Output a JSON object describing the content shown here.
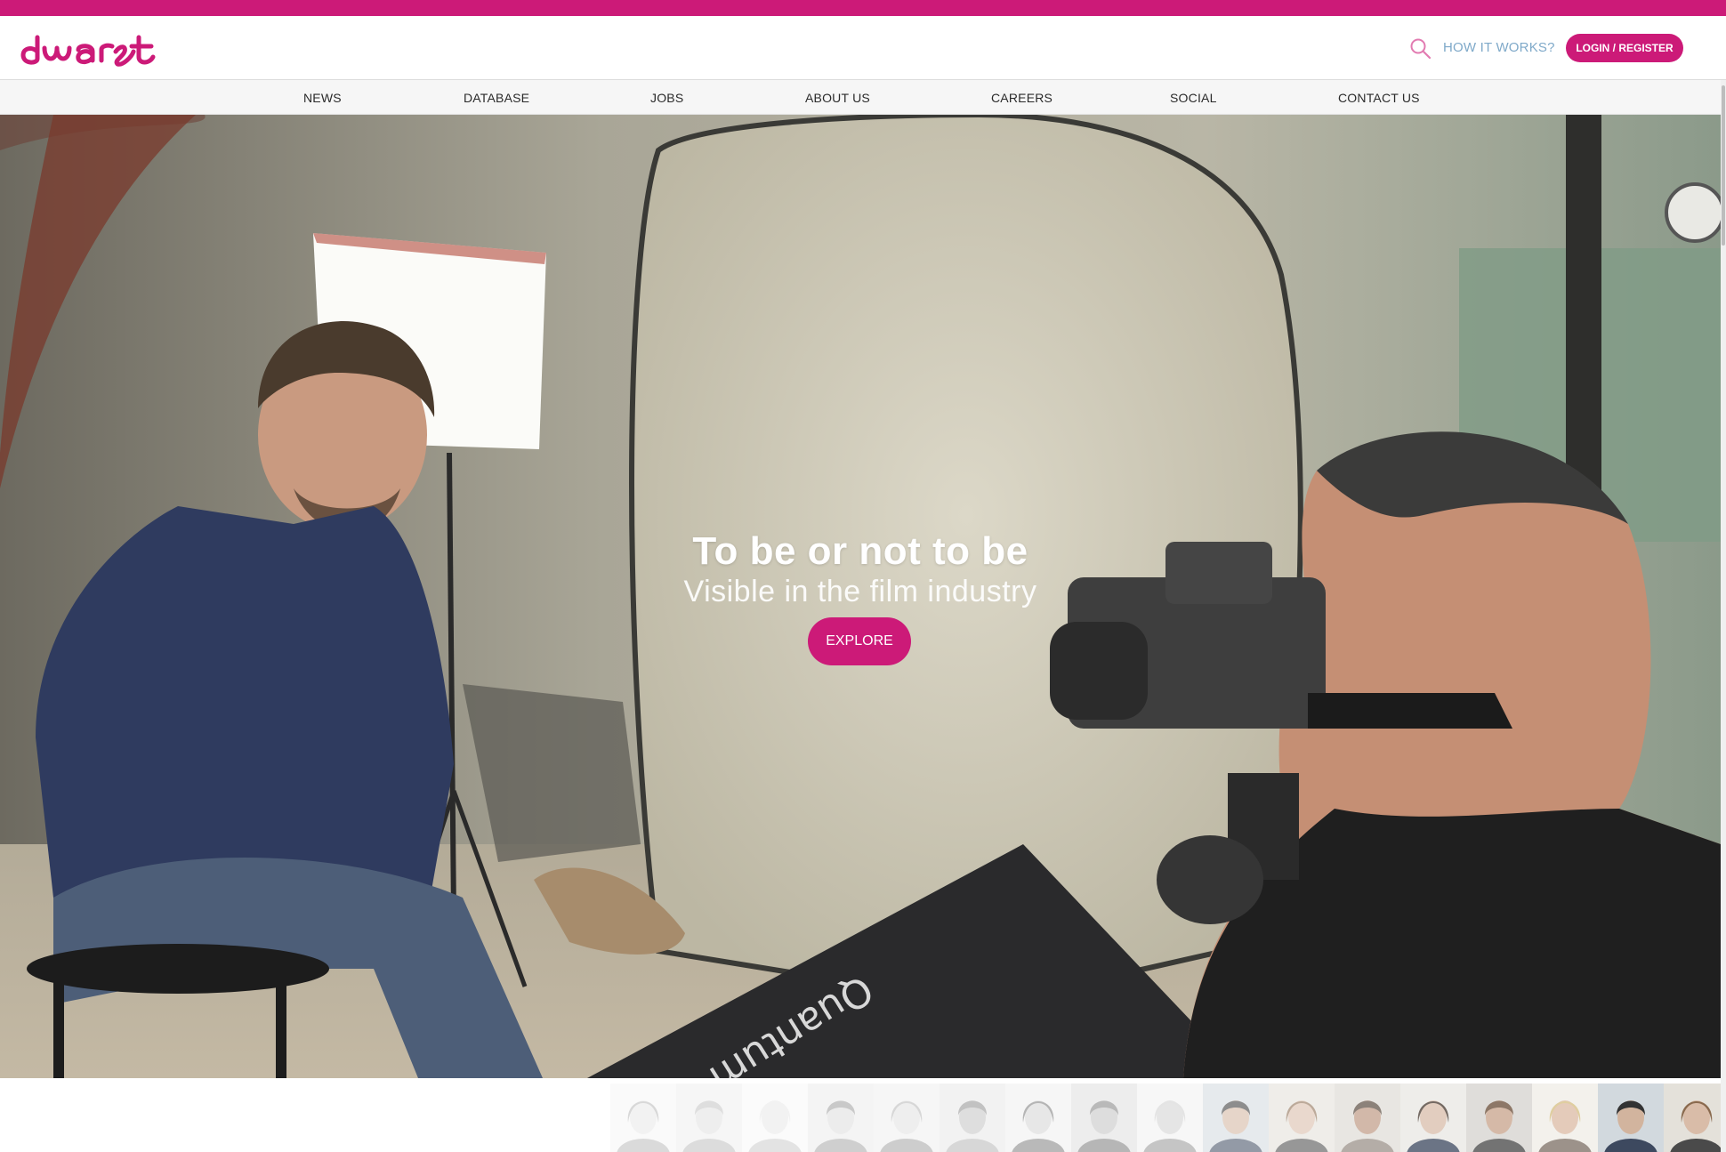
{
  "brand": {
    "logo_text": "dwart",
    "accent_color": "#cc1a78",
    "link_color": "#7fa9c9"
  },
  "header": {
    "search_icon": "search-icon",
    "how_it_works": "HOW IT WORKS?",
    "login_register": "LOGIN / REGISTER"
  },
  "nav": {
    "items": [
      "NEWS",
      "DATABASE",
      "JOBS",
      "ABOUT US",
      "CAREERS",
      "SOCIAL",
      "CONTACT US"
    ]
  },
  "hero": {
    "title": "To be or not to be",
    "subtitle": "Visible in the film industry",
    "cta": "EXPLORE",
    "softbox_text": "Quantum"
  },
  "face_strip": {
    "count": 17
  }
}
